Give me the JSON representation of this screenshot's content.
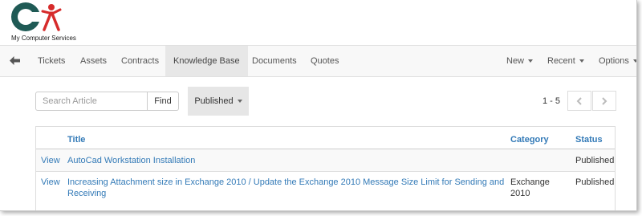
{
  "brand": {
    "company_name": "My Computer Services",
    "colors": {
      "ring": "#1f5a55",
      "figure": "#d62b2b"
    }
  },
  "nav": {
    "back_icon": "arrow-left-icon",
    "items": [
      {
        "label": "Tickets"
      },
      {
        "label": "Assets"
      },
      {
        "label": "Contracts"
      },
      {
        "label": "Knowledge Base",
        "active": true
      },
      {
        "label": "Documents"
      },
      {
        "label": "Quotes"
      }
    ],
    "right_items": [
      {
        "label": "New"
      },
      {
        "label": "Recent"
      },
      {
        "label": "Options"
      }
    ]
  },
  "search": {
    "placeholder": "Search Article",
    "value": "",
    "button_label": "Find"
  },
  "filter": {
    "selected": "Published"
  },
  "pager": {
    "range": "1 - 5",
    "prev_icon": "chevron-left-icon",
    "next_icon": "chevron-right-icon"
  },
  "table": {
    "columns": [
      "Title",
      "Category",
      "Status"
    ],
    "rows": [
      {
        "action": "View",
        "title": "AutoCad Workstation Installation",
        "category": "",
        "status": "Published"
      },
      {
        "action": "View",
        "title_line1": "Increasing Attachment size in Exchange 2010 / Update the Exchange 2010 Message Size Limit for Sending and",
        "title_line2": "Receiving",
        "category_line1": "Exchange",
        "category_line2": "2010",
        "status": "Published"
      }
    ]
  },
  "colors": {
    "link": "#337ab7",
    "navbar_bg": "#f8f8f8",
    "active_tab_bg": "#e7e7e7"
  }
}
